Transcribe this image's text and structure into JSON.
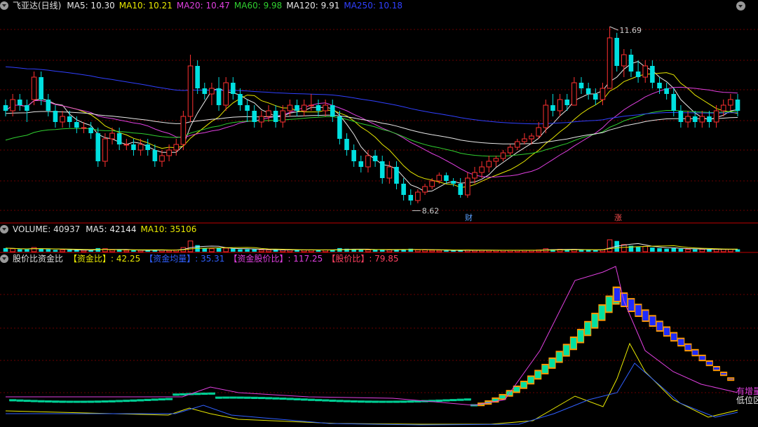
{
  "main_header": {
    "title": "飞亚达(日线)",
    "ma": [
      {
        "label": "MA5: 10.30",
        "color": "#e8e8e8"
      },
      {
        "label": "MA10: 10.21",
        "color": "#e8e800"
      },
      {
        "label": "MA20: 10.47",
        "color": "#e040e0"
      },
      {
        "label": "MA60: 9.98",
        "color": "#30d030"
      },
      {
        "label": "MA120: 9.91",
        "color": "#e8e8e8"
      },
      {
        "label": "MA250: 10.18",
        "color": "#3040ff"
      }
    ]
  },
  "volume_header": {
    "title": "VOLUME: 40937",
    "ma": [
      {
        "label": "MA5: 42144",
        "color": "#e8e8e8"
      },
      {
        "label": "MA10: 35106",
        "color": "#e8e800"
      }
    ]
  },
  "indicator_header": {
    "title": "股价比资金比",
    "items": [
      {
        "label": "【资金比】: 42.25",
        "color": "#e8e800"
      },
      {
        "label": "【资金均量】: 35.31",
        "color": "#3060ff"
      },
      {
        "label": "【资金股价比】: 117.25",
        "color": "#e040e0"
      },
      {
        "label": "【股价比】: 79.85",
        "color": "#ff4060"
      }
    ]
  },
  "markers": {
    "high": "11.69",
    "low": "8.62",
    "cai": "财",
    "zhang": "涨"
  },
  "indicator_right_labels": [
    "有增量",
    "低位区"
  ],
  "colors": {
    "up": "#ff3030",
    "down": "#00e0e0",
    "grid": "#6a0000",
    "background": "#000000"
  },
  "chart_data": [
    {
      "type": "candlestick",
      "title": "飞亚达(日线)",
      "ylim": [
        8.3,
        12.05
      ],
      "annotations": [
        {
          "text": "11.69",
          "at": "max-high"
        },
        {
          "text": "8.62",
          "at": "min-low"
        }
      ],
      "candles": [
        [
          10.4,
          10.5,
          10.2,
          10.3
        ],
        [
          10.3,
          10.6,
          10.2,
          10.5
        ],
        [
          10.5,
          10.6,
          10.3,
          10.4
        ],
        [
          10.4,
          10.5,
          10.1,
          10.3
        ],
        [
          10.5,
          11.0,
          10.4,
          10.9
        ],
        [
          10.9,
          11.0,
          10.4,
          10.5
        ],
        [
          10.5,
          10.6,
          10.2,
          10.3
        ],
        [
          10.3,
          10.4,
          10.0,
          10.1
        ],
        [
          10.1,
          10.3,
          10.0,
          10.2
        ],
        [
          10.2,
          10.3,
          10.0,
          10.1
        ],
        [
          10.1,
          10.2,
          9.9,
          10.0
        ],
        [
          10.0,
          10.1,
          9.9,
          10.0
        ],
        [
          10.0,
          10.1,
          9.8,
          9.9
        ],
        [
          9.9,
          10.0,
          9.3,
          9.4
        ],
        [
          9.4,
          9.9,
          9.3,
          9.8
        ],
        [
          9.8,
          10.0,
          9.7,
          9.9
        ],
        [
          9.9,
          10.0,
          9.6,
          9.7
        ],
        [
          9.7,
          9.8,
          9.6,
          9.7
        ],
        [
          9.7,
          9.8,
          9.5,
          9.6
        ],
        [
          9.6,
          9.8,
          9.5,
          9.7
        ],
        [
          9.7,
          9.8,
          9.5,
          9.6
        ],
        [
          9.6,
          9.7,
          9.3,
          9.4
        ],
        [
          9.4,
          9.6,
          9.3,
          9.5
        ],
        [
          9.5,
          9.7,
          9.4,
          9.6
        ],
        [
          9.6,
          9.8,
          9.5,
          9.7
        ],
        [
          9.7,
          10.3,
          9.6,
          10.2
        ],
        [
          10.2,
          11.3,
          10.1,
          11.1
        ],
        [
          11.1,
          11.2,
          10.6,
          10.7
        ],
        [
          10.7,
          10.8,
          10.5,
          10.6
        ],
        [
          10.6,
          10.8,
          10.4,
          10.7
        ],
        [
          10.7,
          10.9,
          10.3,
          10.4
        ],
        [
          10.4,
          10.9,
          10.3,
          10.8
        ],
        [
          10.8,
          10.9,
          10.5,
          10.6
        ],
        [
          10.6,
          10.7,
          10.3,
          10.4
        ],
        [
          10.4,
          10.5,
          10.1,
          10.3
        ],
        [
          10.3,
          10.4,
          10.0,
          10.1
        ],
        [
          10.1,
          10.3,
          10.0,
          10.2
        ],
        [
          10.2,
          10.4,
          10.1,
          10.3
        ],
        [
          10.3,
          10.4,
          10.0,
          10.1
        ],
        [
          10.1,
          10.4,
          10.0,
          10.3
        ],
        [
          10.3,
          10.5,
          10.2,
          10.4
        ],
        [
          10.4,
          10.5,
          10.2,
          10.3
        ],
        [
          10.3,
          10.5,
          10.2,
          10.4
        ],
        [
          10.4,
          10.6,
          10.3,
          10.4
        ],
        [
          10.4,
          10.5,
          10.2,
          10.3
        ],
        [
          10.3,
          10.5,
          10.2,
          10.4
        ],
        [
          10.4,
          10.5,
          10.1,
          10.2
        ],
        [
          10.2,
          10.3,
          9.7,
          9.8
        ],
        [
          9.8,
          9.9,
          9.5,
          9.6
        ],
        [
          9.6,
          9.7,
          9.3,
          9.4
        ],
        [
          9.4,
          9.5,
          9.2,
          9.3
        ],
        [
          9.3,
          9.6,
          9.2,
          9.5
        ],
        [
          9.5,
          9.6,
          9.3,
          9.4
        ],
        [
          9.4,
          9.5,
          9.0,
          9.1
        ],
        [
          9.1,
          9.4,
          9.0,
          9.3
        ],
        [
          9.3,
          9.4,
          8.9,
          9.0
        ],
        [
          9.0,
          9.1,
          8.7,
          8.8
        ],
        [
          8.8,
          8.9,
          8.62,
          8.7
        ],
        [
          8.7,
          8.9,
          8.65,
          8.85
        ],
        [
          8.85,
          9.0,
          8.8,
          8.95
        ],
        [
          8.95,
          9.1,
          8.9,
          9.05
        ],
        [
          9.05,
          9.2,
          9.0,
          9.15
        ],
        [
          9.15,
          9.2,
          9.0,
          9.05
        ],
        [
          9.05,
          9.1,
          8.95,
          9.0
        ],
        [
          9.0,
          9.1,
          8.75,
          8.8
        ],
        [
          8.8,
          9.2,
          8.75,
          9.1
        ],
        [
          9.1,
          9.3,
          9.0,
          9.2
        ],
        [
          9.2,
          9.4,
          9.1,
          9.3
        ],
        [
          9.3,
          9.5,
          9.2,
          9.4
        ],
        [
          9.4,
          9.5,
          9.3,
          9.45
        ],
        [
          9.45,
          9.6,
          9.4,
          9.55
        ],
        [
          9.55,
          9.7,
          9.5,
          9.65
        ],
        [
          9.65,
          9.8,
          9.6,
          9.75
        ],
        [
          9.75,
          9.9,
          9.7,
          9.8
        ],
        [
          9.8,
          9.9,
          9.7,
          9.85
        ],
        [
          9.85,
          10.1,
          9.8,
          10.0
        ],
        [
          10.0,
          10.5,
          9.9,
          10.4
        ],
        [
          10.4,
          10.6,
          10.2,
          10.3
        ],
        [
          10.3,
          10.6,
          10.2,
          10.5
        ],
        [
          10.5,
          10.6,
          10.3,
          10.4
        ],
        [
          10.4,
          10.9,
          10.4,
          10.8
        ],
        [
          10.8,
          10.9,
          10.6,
          10.7
        ],
        [
          10.7,
          10.8,
          10.5,
          10.6
        ],
        [
          10.6,
          10.7,
          10.4,
          10.5
        ],
        [
          10.5,
          10.8,
          10.4,
          10.7
        ],
        [
          10.7,
          11.8,
          10.7,
          11.6
        ],
        [
          11.6,
          11.69,
          11.0,
          11.1
        ],
        [
          11.1,
          11.4,
          10.9,
          11.3
        ],
        [
          11.3,
          11.4,
          10.9,
          11.0
        ],
        [
          11.0,
          11.2,
          10.8,
          10.9
        ],
        [
          10.9,
          11.2,
          10.8,
          11.1
        ],
        [
          11.1,
          11.2,
          10.7,
          10.8
        ],
        [
          10.8,
          10.9,
          10.6,
          10.7
        ],
        [
          10.7,
          10.8,
          10.5,
          10.6
        ],
        [
          10.6,
          10.7,
          10.2,
          10.3
        ],
        [
          10.3,
          10.4,
          10.0,
          10.1
        ],
        [
          10.1,
          10.3,
          10.0,
          10.2
        ],
        [
          10.2,
          10.3,
          10.0,
          10.1
        ],
        [
          10.1,
          10.3,
          10.0,
          10.2
        ],
        [
          10.2,
          10.3,
          10.0,
          10.1
        ],
        [
          10.1,
          10.4,
          10.0,
          10.3
        ],
        [
          10.3,
          10.5,
          10.2,
          10.4
        ],
        [
          10.4,
          10.6,
          10.3,
          10.5
        ],
        [
          10.5,
          10.6,
          10.2,
          10.3
        ]
      ],
      "series": [
        {
          "name": "MA5",
          "color": "#e8e8e8",
          "last": 10.3
        },
        {
          "name": "MA10",
          "color": "#e8e800",
          "last": 10.21
        },
        {
          "name": "MA20",
          "color": "#e040e0",
          "last": 10.47
        },
        {
          "name": "MA60",
          "color": "#30d030",
          "last": 9.98
        },
        {
          "name": "MA120",
          "color": "#e8e8e8",
          "last": 9.91
        },
        {
          "name": "MA250",
          "color": "#3040ff",
          "last": 10.18
        }
      ]
    },
    {
      "type": "bar",
      "title": "VOLUME",
      "values_relative": [
        0.3,
        0.25,
        0.2,
        0.2,
        0.35,
        0.25,
        0.2,
        0.15,
        0.15,
        0.15,
        0.15,
        0.12,
        0.12,
        0.3,
        0.25,
        0.15,
        0.15,
        0.12,
        0.12,
        0.12,
        0.12,
        0.18,
        0.15,
        0.12,
        0.15,
        0.35,
        0.9,
        0.55,
        0.3,
        0.25,
        0.3,
        0.3,
        0.25,
        0.2,
        0.2,
        0.2,
        0.15,
        0.15,
        0.15,
        0.15,
        0.15,
        0.15,
        0.15,
        0.15,
        0.15,
        0.15,
        0.15,
        0.3,
        0.25,
        0.2,
        0.15,
        0.15,
        0.15,
        0.2,
        0.15,
        0.15,
        0.2,
        0.25,
        0.15,
        0.15,
        0.12,
        0.12,
        0.1,
        0.1,
        0.15,
        0.15,
        0.12,
        0.12,
        0.12,
        0.12,
        0.12,
        0.12,
        0.12,
        0.12,
        0.12,
        0.15,
        0.25,
        0.2,
        0.2,
        0.15,
        0.2,
        0.15,
        0.15,
        0.12,
        0.15,
        1.0,
        0.9,
        0.6,
        0.5,
        0.4,
        0.45,
        0.35,
        0.3,
        0.25,
        0.3,
        0.25,
        0.2,
        0.2,
        0.2,
        0.2,
        0.2,
        0.2,
        0.2,
        0.2
      ]
    },
    {
      "type": "line",
      "title": "股价比资金比",
      "series": [
        {
          "name": "资金比",
          "color": "#e8e800",
          "last": 42.25
        },
        {
          "name": "资金均量",
          "color": "#3060ff",
          "last": 35.31
        },
        {
          "name": "资金股价比",
          "color": "#e040e0",
          "last": 117.25
        },
        {
          "name": "股价比",
          "color": "#ff4060",
          "last": 79.85
        }
      ]
    }
  ]
}
